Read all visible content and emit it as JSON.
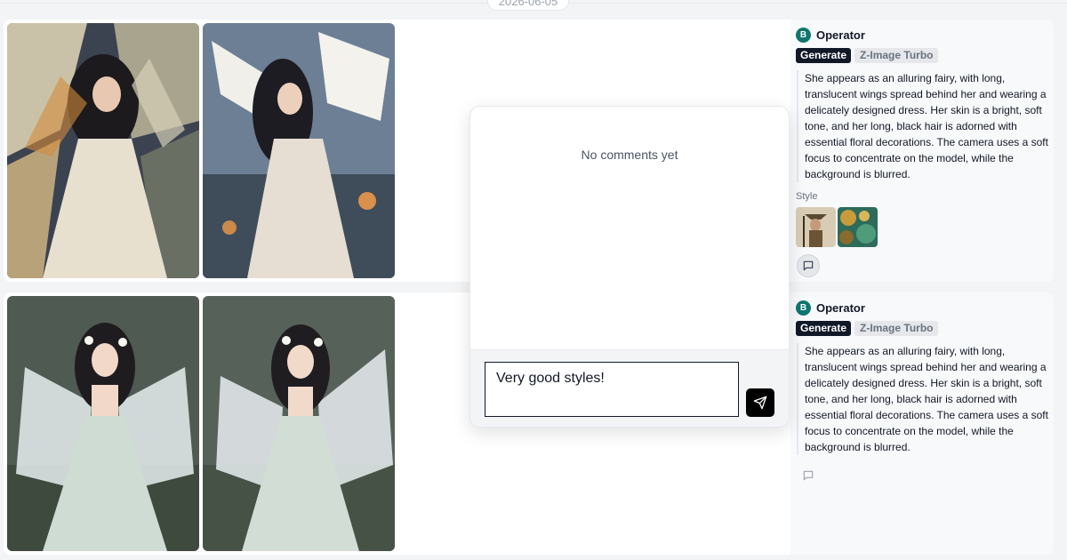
{
  "timeline": {
    "date": "2026-06-05"
  },
  "generations": [
    {
      "operator": {
        "initial": "B",
        "name": "Operator"
      },
      "action_tag": "Generate",
      "model_tag": "Z-Image Turbo",
      "prompt": "She appears as an alluring fairy, with long, translucent wings spread behind her and wearing a delicately designed dress. Her skin is a bright, soft tone, and her long, black hair is adorned with essential floral decorations. The camera uses a soft focus to concentrate on the model, while the background is blurred.",
      "style_label": "Style",
      "style_refs": [
        "style-image-1",
        "style-image-2"
      ],
      "comment_icon": "comment-icon"
    },
    {
      "operator": {
        "initial": "B",
        "name": "Operator"
      },
      "action_tag": "Generate",
      "model_tag": "Z-Image Turbo",
      "prompt": "She appears as an alluring fairy, with long, translucent wings spread behind her and wearing a delicately designed dress. Her skin is a bright, soft tone, and her long, black hair is adorned with essential floral decorations. The camera uses a soft focus to concentrate on the model, while the background is blurred.",
      "comment_icon": "comment-icon"
    }
  ],
  "comments_popup": {
    "empty_text": "No comments yet",
    "input_value": "Very good styles!",
    "send_icon": "send-icon"
  },
  "colors": {
    "accent": "#111827",
    "avatar": "#0f766e"
  }
}
